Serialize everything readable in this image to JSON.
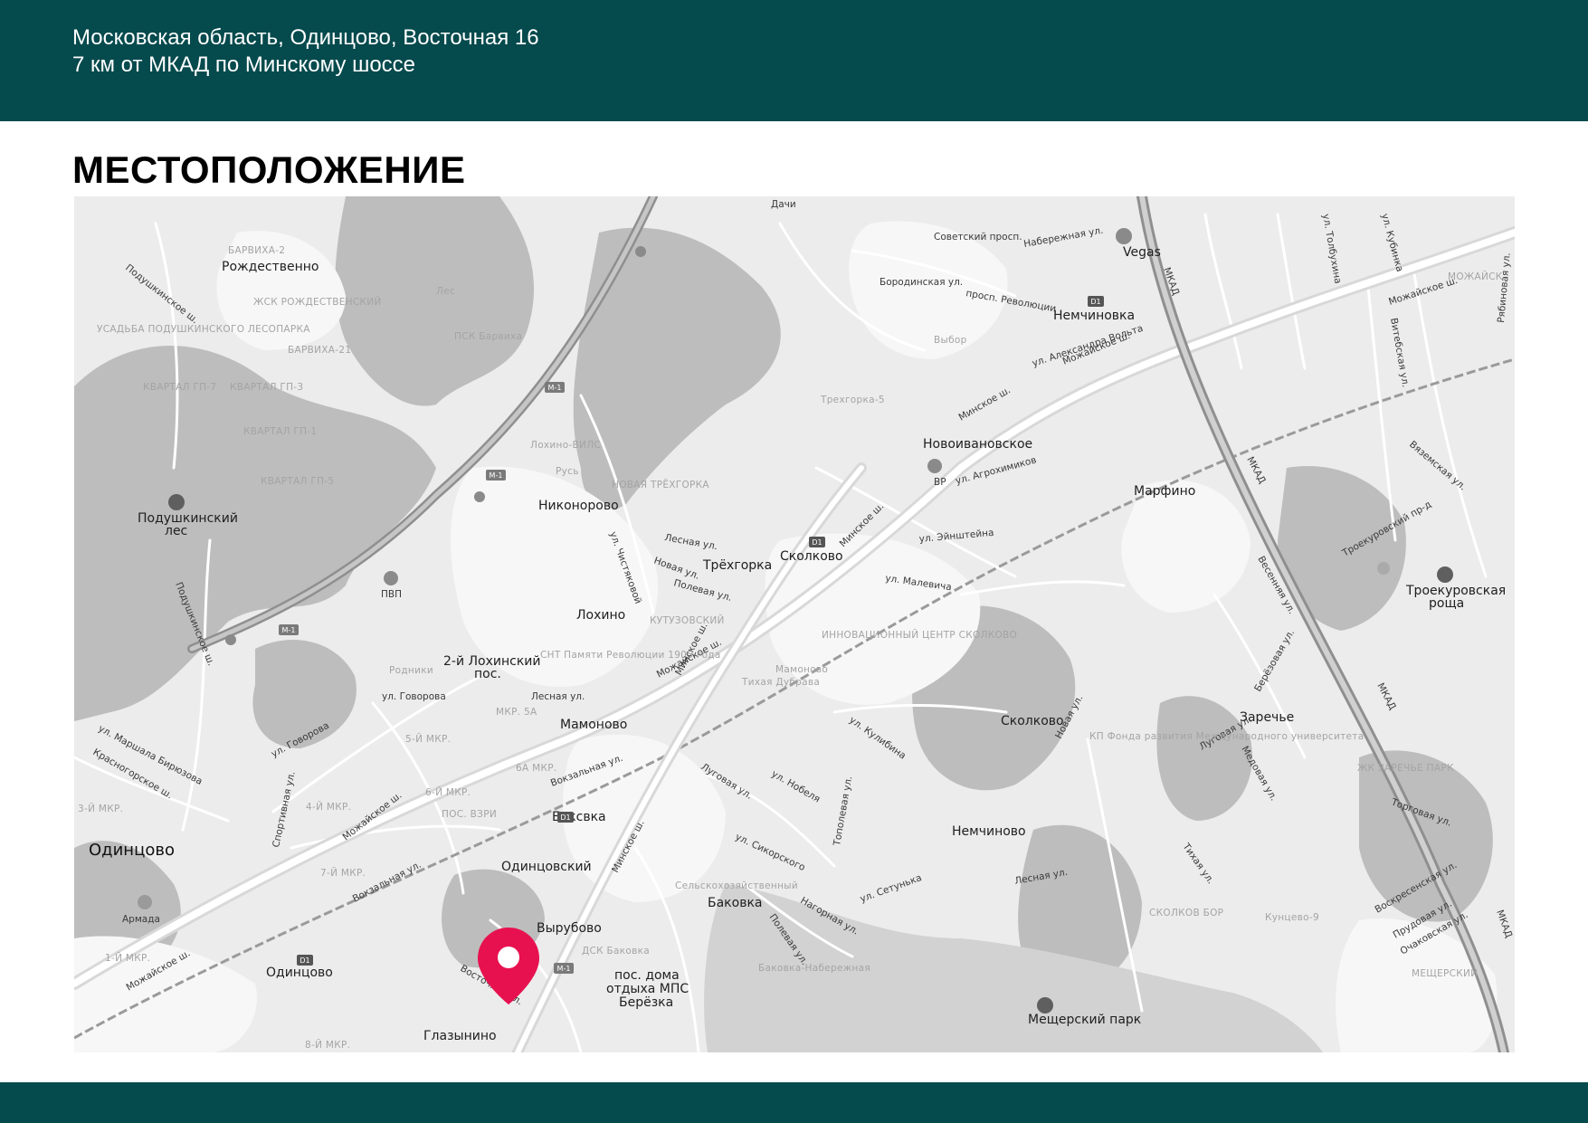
{
  "header": {
    "address_line1": "Московская область, Одинцово, Восточная 16",
    "address_line2": "7 км от МКАД по Минскому шоссе",
    "band_color": "#054a4d"
  },
  "section": {
    "title": "МЕСТОПОЛОЖЕНИЕ"
  },
  "map": {
    "marker_color": "#e8114f",
    "places": [
      "Рождественно",
      "Подушкинский",
      "лес",
      "Никонорово",
      "Трёхгорка",
      "Сколково",
      "Лохино",
      "2-й Лохинский",
      "пос.",
      "Мамоново",
      "Баксвка",
      "Одинцовский",
      "Одинцово",
      "Вырубово",
      "Баковка",
      "пос. дома",
      "отдыха МПС",
      "Берёзка",
      "Глазынино",
      "Новоивановское",
      "Марфино",
      "Сколково",
      "Заречье",
      "Немчиново",
      "Немчиновка",
      "Троекуровская",
      "роща",
      "Мещерский парк",
      "Vegas",
      "Армада",
      "BP",
      "Дачи",
      "ПВП"
    ],
    "streets": [
      "Минское ш.",
      "Можайское ш.",
      "МКАД",
      "ул. Говорова",
      "Подушкинское ш.",
      "Красногорское ш.",
      "Лесная ул.",
      "Новая ул.",
      "Полевая ул.",
      "Восточная ул.",
      "Вокзальная ул.",
      "ул. Маршала Бирюзова",
      "Спортивная ул.",
      "ул. Чистяковой",
      "Луговая ул.",
      "ул. Нобеля",
      "ул. Кулибина",
      "ул. Сикорского",
      "ул. Сетунька",
      "Нагорная ул.",
      "Весенняя ул.",
      "Берёзовая ул.",
      "Медовая ул.",
      "Новая ул.",
      "ул. Малевича",
      "ул. Эйнштейна",
      "ул. Агрохимиков",
      "ул. Александра Вольта",
      "Советский просп.",
      "Набережная ул.",
      "Бородинская ул.",
      "просп. Революции",
      "ул. Толбухина",
      "ул. Кубинка",
      "Рябиновая ул.",
      "Витебская ул.",
      "Вяземская ул.",
      "Троекуровский пр-д",
      "Воскресенская ул.",
      "Прудовая ул.",
      "Очаковская ул.",
      "Тихая ул.",
      "Тополевая ул.",
      "Торговая ул."
    ],
    "districts": [
      "БАРВИХА-2",
      "ЖСК РОЖДЕСТВЕНСКИЙ",
      "УСАДЬБА ПОДУШКИНСКОГО ЛЕСОПАРКА",
      "БАРВИХА-21",
      "КВАРТАЛ ГП-7",
      "КВАРТАЛ ГП-3",
      "КВАРТАЛ ГП-1",
      "КВАРТАЛ ГП-5",
      "ПСК Барвиха",
      "Трехгорка-5",
      "Лохино-ВИЛС",
      "Русь",
      "НОВАЯ ТРЁХГОРКА",
      "КУТУЗОВСКИЙ",
      "СНТ Памяти Революции 1905 года",
      "Родники",
      "ИННОВАЦИОННЫЙ ЦЕНТР СКОЛКОВО",
      "Мамоново",
      "Тихая Дубрава",
      "МКР. 5А",
      "5-Й МКР.",
      "6А МКР.",
      "6-Й МКР.",
      "4-Й МКР.",
      "ПОС. ВЗРИ",
      "7-Й МКР.",
      "3-Й МКР.",
      "1-Й МКР.",
      "8-Й МКР.",
      "Сельскохозяйственный",
      "ДСК Баковка",
      "Баковка-Набережная",
      "КП Фонда развития Международного университета",
      "ЖК ЗАРЕЧЬЕ ПАРК",
      "СКОЛКОВ БОР",
      "Кунцево-9",
      "МЕЩЕРСКИЙ",
      "МОЖАЙСК",
      "Выбор",
      "Лес"
    ],
    "road_shields": [
      "M-1",
      "D1"
    ]
  }
}
